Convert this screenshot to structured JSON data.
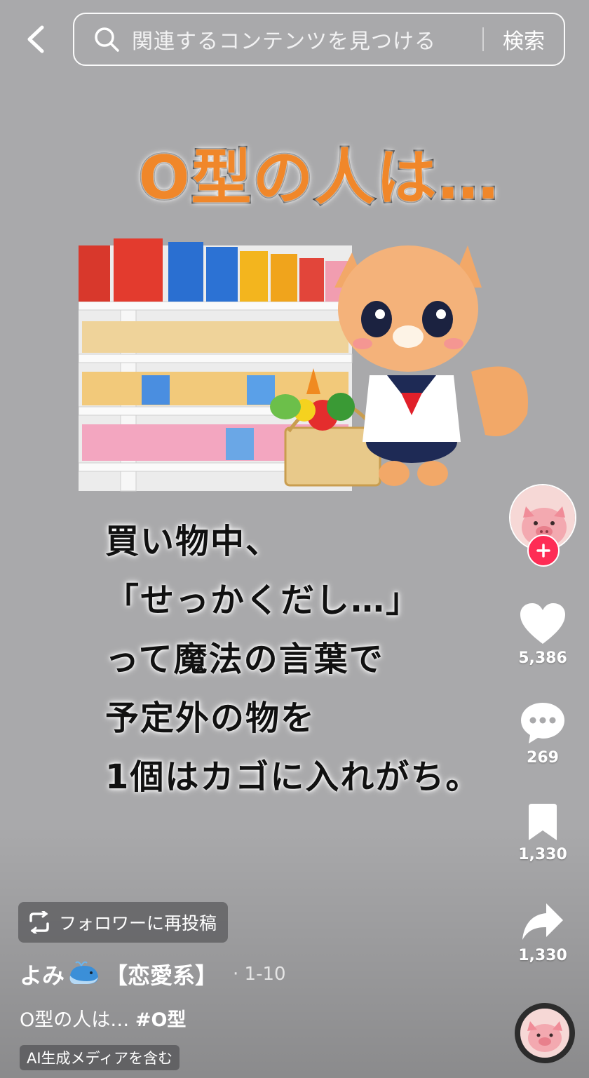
{
  "topbar": {
    "search_placeholder": "関連するコンテンツを見つける",
    "search_button": "検索"
  },
  "video": {
    "title": "O型の人は…",
    "text_lines": "買い物中、\n「せっかくだし…」\nって魔法の言葉で\n予定外の物を\n1個はカゴに入れがち。"
  },
  "rail": {
    "likes": "5,386",
    "comments": "269",
    "bookmarks": "1,330",
    "shares": "1,330"
  },
  "info": {
    "repost_label": "フォロワーに再投稿",
    "author_name": "よみ",
    "author_tag": "【恋愛系】",
    "date": "· 1-10",
    "caption_text": "O型の人は… ",
    "caption_hashtag": "#O型",
    "ai_label": "AI生成メディアを含む"
  },
  "colors": {
    "accent_red": "#fe2c55",
    "title_orange": "#f0872a",
    "background": "#a9a9ab"
  }
}
